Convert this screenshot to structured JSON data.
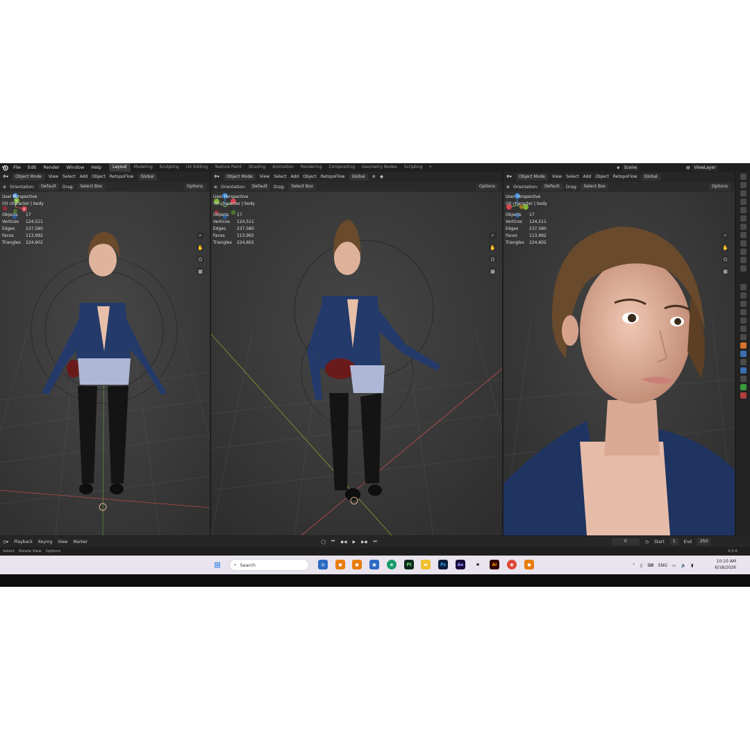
{
  "topbar": {
    "menus": [
      "File",
      "Edit",
      "Render",
      "Window",
      "Help"
    ],
    "tabs": [
      "Layout",
      "Modeling",
      "Sculpting",
      "UV Editing",
      "Texture Paint",
      "Shading",
      "Animation",
      "Rendering",
      "Compositing",
      "Geometry Nodes",
      "Scripting"
    ],
    "active_tab": "Layout",
    "add_tab": "+",
    "scene": "Scene",
    "view_layer": "ViewLayer"
  },
  "viewports": [
    {
      "mode": "Object Mode",
      "menus": [
        "View",
        "Select",
        "Add",
        "Object",
        "RetopoFlow"
      ],
      "transform": "Global",
      "orientation_label": "Orientation:",
      "orientation": "Default",
      "drag_label": "Drag:",
      "drag": "Select Box",
      "options": "Options",
      "title": "User Perspective",
      "collection": "(0) character | body",
      "stats": [
        {
          "k": "Objects",
          "v": "17"
        },
        {
          "k": "Vertices",
          "v": "124,511"
        },
        {
          "k": "Edges",
          "v": "237,580"
        },
        {
          "k": "Faces",
          "v": "113,992"
        },
        {
          "k": "Triangles",
          "v": "224,602"
        }
      ]
    },
    {
      "mode": "Object Mode",
      "menus": [
        "View",
        "Select",
        "Add",
        "Object",
        "RetopoFlow"
      ],
      "transform": "Global",
      "orientation_label": "Orientation:",
      "orientation": "Default",
      "drag_label": "Drag:",
      "drag": "Select Box",
      "options": "Options",
      "title": "User Perspective",
      "collection": "(0) character | body",
      "stats": [
        {
          "k": "Objects",
          "v": "17"
        },
        {
          "k": "Vertices",
          "v": "124,511"
        },
        {
          "k": "Edges",
          "v": "237,580"
        },
        {
          "k": "Faces",
          "v": "113,992"
        },
        {
          "k": "Triangles",
          "v": "224,602"
        }
      ]
    },
    {
      "mode": "Object Mode",
      "menus": [
        "View",
        "Select",
        "Add",
        "Object",
        "RetopoFlow"
      ],
      "transform": "Global",
      "orientation_label": "Orientation:",
      "orientation": "Default",
      "drag_label": "Drag:",
      "drag": "Select Box",
      "options": "Options",
      "title": "User Perspective",
      "collection": "(0) character | body",
      "stats": [
        {
          "k": "Objects",
          "v": "17"
        },
        {
          "k": "Vertices",
          "v": "124,511"
        },
        {
          "k": "Edges",
          "v": "237,580"
        },
        {
          "k": "Faces",
          "v": "113,992"
        },
        {
          "k": "Triangles",
          "v": "224,602"
        }
      ]
    }
  ],
  "gizmo_axes": [
    "Z",
    "Y",
    "X"
  ],
  "timeline": {
    "menus": [
      "Playback",
      "Keying",
      "View",
      "Marker"
    ],
    "current_frame": "0",
    "start_label": "Start",
    "start": "1",
    "end_label": "End",
    "end": "250"
  },
  "statusbar": {
    "items": [
      "Select",
      "Rotate View",
      "Options"
    ],
    "version": "4.5.6"
  },
  "taskbar": {
    "search_placeholder": "Search",
    "apps": [
      "Pt",
      "Ps",
      "Ae",
      "Ai"
    ],
    "tray_lang": "ENG",
    "time": "10:10 AM",
    "date": "6/18/2026"
  },
  "colors": {
    "accent": "#4772b3",
    "axis_x": "#d1434e",
    "axis_y": "#7cb33a",
    "axis_z": "#3a84d1"
  }
}
